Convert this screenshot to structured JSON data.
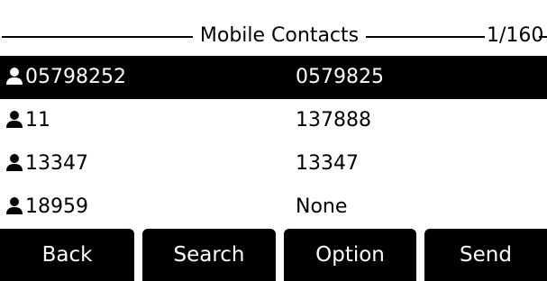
{
  "header": {
    "title": "Mobile Contacts",
    "page_indicator": "1/160"
  },
  "contacts": [
    {
      "name": "05798252",
      "number": "0579825",
      "selected": true
    },
    {
      "name": "11",
      "number": "137888",
      "selected": false
    },
    {
      "name": "13347",
      "number": "13347",
      "selected": false
    },
    {
      "name": "18959",
      "number": "None",
      "selected": false
    }
  ],
  "softkeys": [
    {
      "label": "Back"
    },
    {
      "label": "Search"
    },
    {
      "label": "Option"
    },
    {
      "label": "Send"
    }
  ],
  "icons": {
    "contact": "person-icon"
  },
  "colors": {
    "foreground": "#000000",
    "background": "#ffffff",
    "selection": "#000000"
  }
}
